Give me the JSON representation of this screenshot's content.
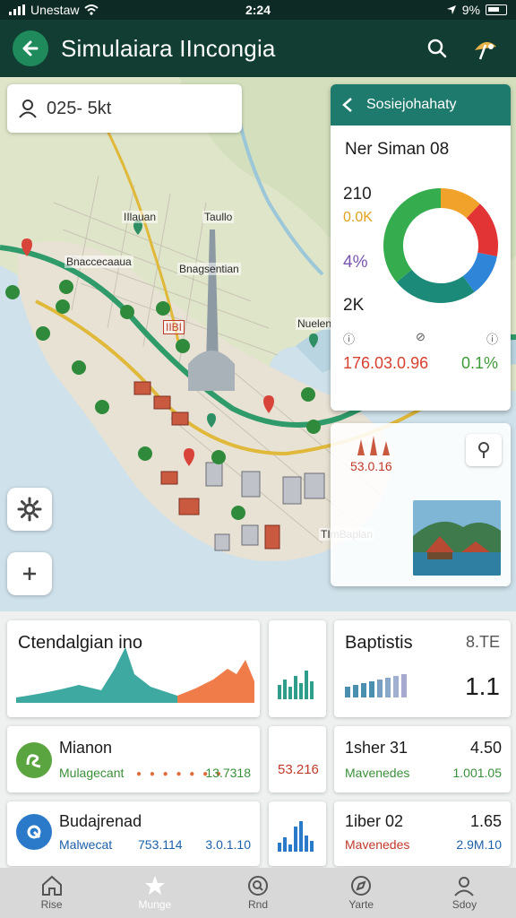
{
  "status_bar": {
    "carrier": "Unestaw",
    "time": "2:24",
    "battery": "9%"
  },
  "app_bar": {
    "title": "Simulaiara IIncongia"
  },
  "search": {
    "value": "025- 5kt"
  },
  "map": {
    "labels": [
      "IIlauan",
      "Taullo",
      "Bnaccecaaua",
      "Bnagsentian",
      "IIBI",
      "TImBaplan",
      "Nuelen"
    ]
  },
  "stats_panel": {
    "header": "Sosiejohahaty",
    "subtitle": "Ner Siman 08",
    "values": [
      {
        "text": "210",
        "color": "#222222"
      },
      {
        "text": "0.0K",
        "color": "#e0a020"
      },
      {
        "text": "4%",
        "color": "#7a56b0"
      },
      {
        "text": "2K",
        "color": "#222222"
      }
    ],
    "footer_left": "176.03.0.96",
    "footer_right": "0.1%",
    "colors": {
      "left": "#d8402f",
      "right": "#3e9a37"
    }
  },
  "donut": {
    "segments": [
      {
        "label": "orange",
        "value": 12,
        "color": "#f0a22a"
      },
      {
        "label": "red",
        "value": 16,
        "color": "#e23434"
      },
      {
        "label": "blue",
        "value": 12,
        "color": "#2f86d8"
      },
      {
        "label": "teal",
        "value": 24,
        "color": "#1b8a78"
      },
      {
        "label": "green",
        "value": 36,
        "color": "#35ad4e"
      }
    ]
  },
  "poi": {
    "label": "53.0.16"
  },
  "cards": {
    "elevation": {
      "title": "Ctendalgian ino"
    },
    "baptistis": {
      "title": "Baptistis",
      "badge": "8.TE",
      "value": "1.1"
    },
    "row1": {
      "title": "Mianon",
      "sub": "Mulagecant",
      "sub_value": "13.7318",
      "mid_value": "53.216"
    },
    "row1_right": {
      "title": "1sher 31",
      "value": "4.50",
      "sub": "Mavenedes",
      "sub_value": "1.001.05"
    },
    "row2": {
      "title": "Budajrenad",
      "sub": "Malwecat",
      "sub_value": "753.114",
      "tail": "3.0.1.10"
    },
    "row2_right": {
      "title": "1iber 02",
      "value": "1.65",
      "sub": "Mavenedes",
      "sub_value": "2.9M.10"
    }
  },
  "bottom_nav": [
    {
      "label": "Rise",
      "icon": "home-icon"
    },
    {
      "label": "Munge",
      "icon": "pin-star-icon"
    },
    {
      "label": "Rnd",
      "icon": "search-circle-icon"
    },
    {
      "label": "Yarte",
      "icon": "compass-icon"
    },
    {
      "label": "Sdoy",
      "icon": "user-icon"
    }
  ]
}
